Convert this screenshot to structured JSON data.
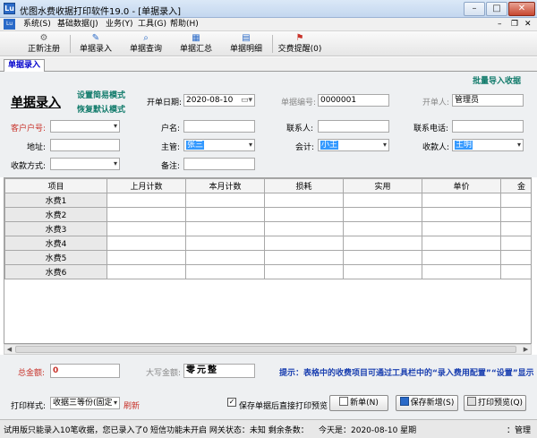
{
  "window": {
    "title": "优图水费收据打印软件19.0 - [单据录入]",
    "app_icon": "Lu",
    "minimize": "–",
    "maximize": "□",
    "close": "✕"
  },
  "menu": {
    "icon_text": "Lu",
    "items": [
      "系统(S)",
      "基础数据(J)",
      "业务(Y)",
      "工具(G)",
      "帮助(H)"
    ],
    "mdi_controls": [
      "–",
      "❐",
      "✕"
    ]
  },
  "toolbar": {
    "buttons": [
      {
        "label": "正新注册",
        "icon": "register-icon",
        "glyph": "⚙"
      },
      {
        "label": "单据录入",
        "icon": "entry-icon",
        "glyph": "✎"
      },
      {
        "label": "单据查询",
        "icon": "query-icon",
        "glyph": "⌕"
      },
      {
        "label": "单据汇总",
        "icon": "summary-icon",
        "glyph": "▦"
      },
      {
        "label": "单据明细",
        "icon": "detail-icon",
        "glyph": "▤"
      },
      {
        "label": "交费提醒(0)",
        "icon": "reminder-icon",
        "glyph": "⚑"
      }
    ]
  },
  "tabs": {
    "active": "单据录入"
  },
  "form": {
    "heading": "单据录入",
    "link_simple_mode": "设置简易模式",
    "link_default_mode": "恢复默认模式",
    "link_batch_import": "批量导入收据",
    "date_label": "开单日期:",
    "date_value": "2020-08-10",
    "receipt_no_label": "单据编号:",
    "receipt_no_value": "0000001",
    "issuer_label": "开单人:",
    "issuer_value": "管理员",
    "customer_no_label": "客户户号:",
    "customer_no_value": "",
    "account_name_label": "户名:",
    "contact_label": "联系人:",
    "phone_label": "联系电话:",
    "address_label": "地址:",
    "supervisor_label": "主管:",
    "supervisor_value": "张三",
    "accountant_label": "会计:",
    "accountant_value": "小王",
    "payee_label": "收款人:",
    "payee_value": "王明",
    "payment_label": "收款方式:",
    "remark_label": "备注:"
  },
  "grid": {
    "columns": [
      "项目",
      "上月计数",
      "本月计数",
      "损耗",
      "实用",
      "单价",
      "金"
    ],
    "rows": [
      "水费1",
      "水费2",
      "水费3",
      "水费4",
      "水费5",
      "水费6"
    ]
  },
  "scrollbar": {
    "left": "◀",
    "right": "▶"
  },
  "bottom": {
    "total_label": "总金额:",
    "total_value": "0",
    "uppercase_label": "大写金额:",
    "uppercase_value": "零元整",
    "tip": "提示：表格中的收费项目可通过工具栏中的“录入费用配置”“设置”显示",
    "print_style_label": "打印样式:",
    "print_style_value": "收据三等份(固定",
    "refresh": "刷新",
    "preview_checkbox": "保存单据后直接打印预览",
    "btn_new": "新单(N)",
    "btn_save_new": "保存新增(S)",
    "btn_print_preview": "打印预览(Q)"
  },
  "status": {
    "left": "试用版只能录入10笔收据，您已录入了0 短信功能未开启 网关状态：未知 剩余条数：未知",
    "date": "今天是：2020-08-10 星期",
    "right": "：管理"
  }
}
